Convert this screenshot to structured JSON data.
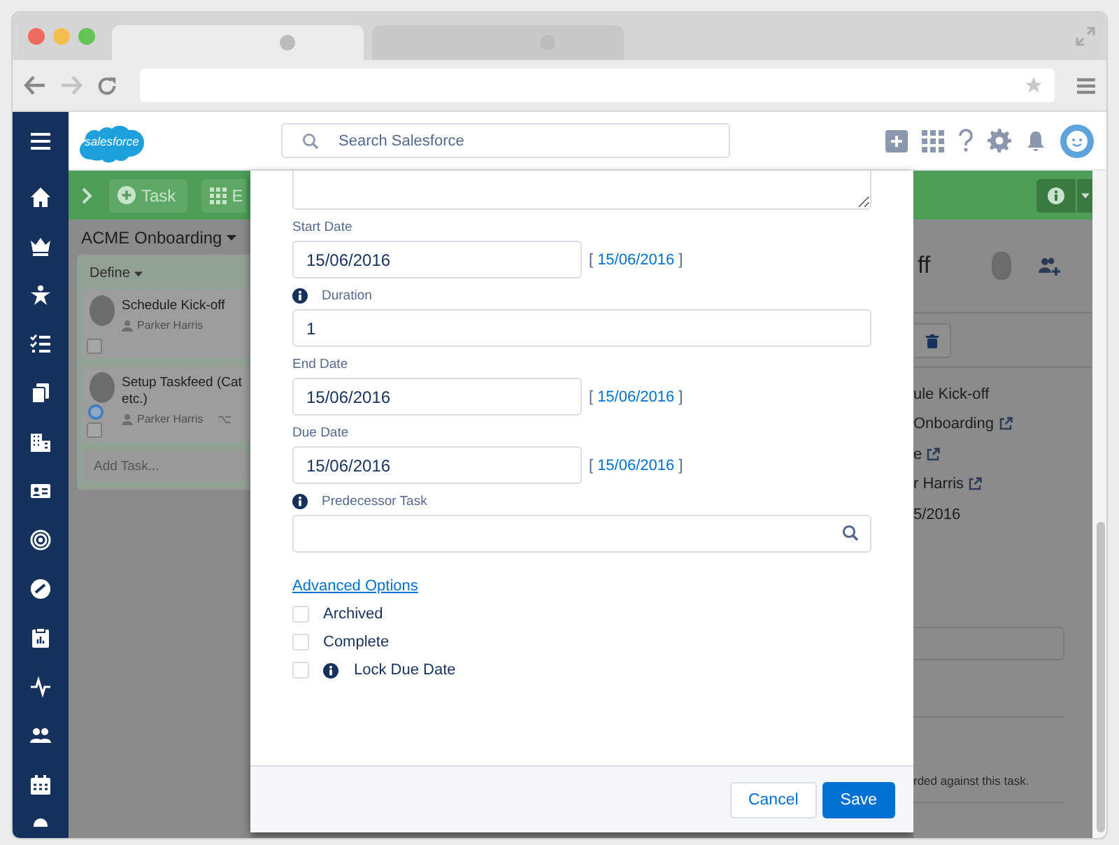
{
  "browser": {
    "tabs": [
      {
        "selected": true
      },
      {
        "selected": false
      }
    ]
  },
  "header": {
    "logo": "salesforce",
    "search": {
      "placeholder": "Search Salesforce"
    }
  },
  "project_panel": {
    "toolbar": [
      {
        "label": "Task",
        "kind": "add"
      },
      {
        "label": "E",
        "kind": "grid"
      }
    ],
    "title": "ACME Onboarding",
    "phase": "Define",
    "tasks": [
      {
        "title": "Schedule Kick-off",
        "assignee": "Parker Harris",
        "status_marker": false,
        "dependency": false,
        "checked": false
      },
      {
        "title": "Setup Taskfeed (Cat\netc.)",
        "assignee": "Parker Harris",
        "status_marker": true,
        "dependency": true,
        "checked": false
      }
    ],
    "add_task": {
      "placeholder": "Add Task..."
    }
  },
  "modal": {
    "fields": [
      {
        "kind": "textarea"
      },
      {
        "kind": "date",
        "label": "Start Date",
        "info": false,
        "value": "15/06/2016",
        "hint": {
          "open": "[",
          "date": "15/06/2016",
          "close": "]"
        }
      },
      {
        "kind": "text",
        "label": "Duration",
        "info": true,
        "value": "1"
      },
      {
        "kind": "date",
        "label": "End Date",
        "info": false,
        "value": "15/06/2016",
        "hint": {
          "open": "[",
          "date": "15/06/2016",
          "close": "]"
        }
      },
      {
        "kind": "date",
        "label": "Due Date",
        "info": false,
        "value": "15/06/2016",
        "hint": {
          "open": "[",
          "date": "15/06/2016",
          "close": "]"
        }
      },
      {
        "kind": "lookup",
        "label": "Predecessor Task",
        "info": true
      }
    ],
    "advanced_link": "Advanced Options",
    "options": [
      {
        "label": "Archived",
        "checked": false,
        "info": false
      },
      {
        "label": "Complete",
        "checked": false,
        "info": false
      },
      {
        "label": "Lock Due Date",
        "checked": false,
        "info": true
      }
    ],
    "buttons": [
      {
        "label": "Cancel",
        "kind": "neutral"
      },
      {
        "label": "Save",
        "kind": "brand"
      }
    ]
  },
  "detail_panel": {
    "title": "ff",
    "rows": [
      {
        "text": "ule Kick-off",
        "external": false
      },
      {
        "text": "Onboarding",
        "external": true
      },
      {
        "text": "e",
        "external": true
      },
      {
        "text": "r Harris",
        "external": true
      },
      {
        "text": "5/2016",
        "external": false
      }
    ],
    "note": "rded against this task."
  }
}
